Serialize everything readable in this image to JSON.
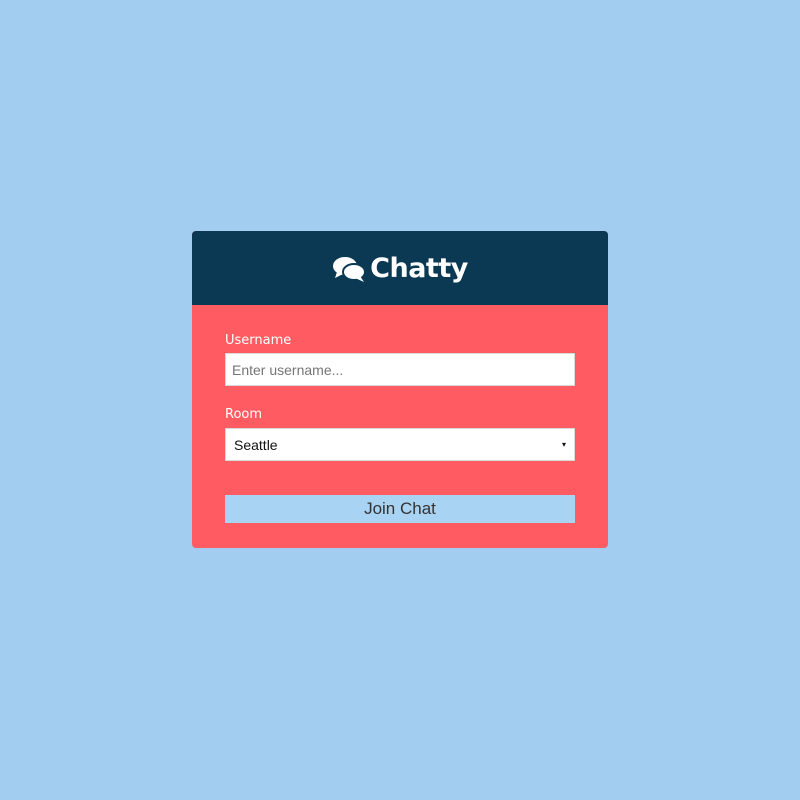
{
  "app": {
    "title": "Chatty",
    "logo_icon": "comments-icon"
  },
  "form": {
    "username_label": "Username",
    "username_placeholder": "Enter username...",
    "username_value": "",
    "room_label": "Room",
    "room_selected": "Seattle",
    "room_arrow": "▾",
    "submit_label": "Join Chat"
  },
  "colors": {
    "page_background": "#a2cdf0",
    "header_background": "#0b3954",
    "card_background": "#fe5c62",
    "button_background": "#a9d3f2"
  }
}
